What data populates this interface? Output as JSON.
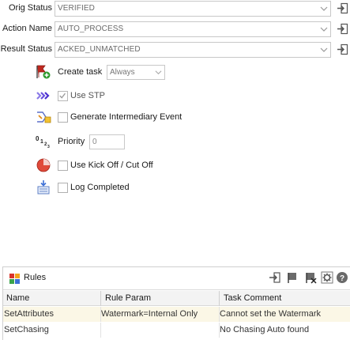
{
  "fields": [
    {
      "label": "Orig Status",
      "value": "VERIFIED"
    },
    {
      "label": "Action Name",
      "value": "AUTO_PROCESS"
    },
    {
      "label": "Result Status",
      "value": "ACKED_UNMATCHED"
    }
  ],
  "options": {
    "create_task_label": "Create task",
    "create_task_value": "Always",
    "use_stp_label": "Use STP",
    "use_stp_checked": true,
    "gen_event_label": "Generate Intermediary Event",
    "priority_label": "Priority",
    "priority_value": "0",
    "kickoff_label": "Use Kick Off / Cut Off",
    "log_completed_label": "Log Completed"
  },
  "rules": {
    "title": "Rules",
    "columns": [
      "Name",
      "Rule Param",
      "Task Comment"
    ],
    "rows": [
      {
        "name": "SetAttributes",
        "param": "Watermark=Internal Only",
        "comment": "Cannot set the Watermark"
      },
      {
        "name": "SetChasing",
        "param": "",
        "comment": "No Chasing Auto found"
      }
    ]
  },
  "colors": {
    "accent_red": "#d9342b",
    "accent_purple": "#5a3fd6",
    "row_highlight": "#fbf7e6"
  }
}
